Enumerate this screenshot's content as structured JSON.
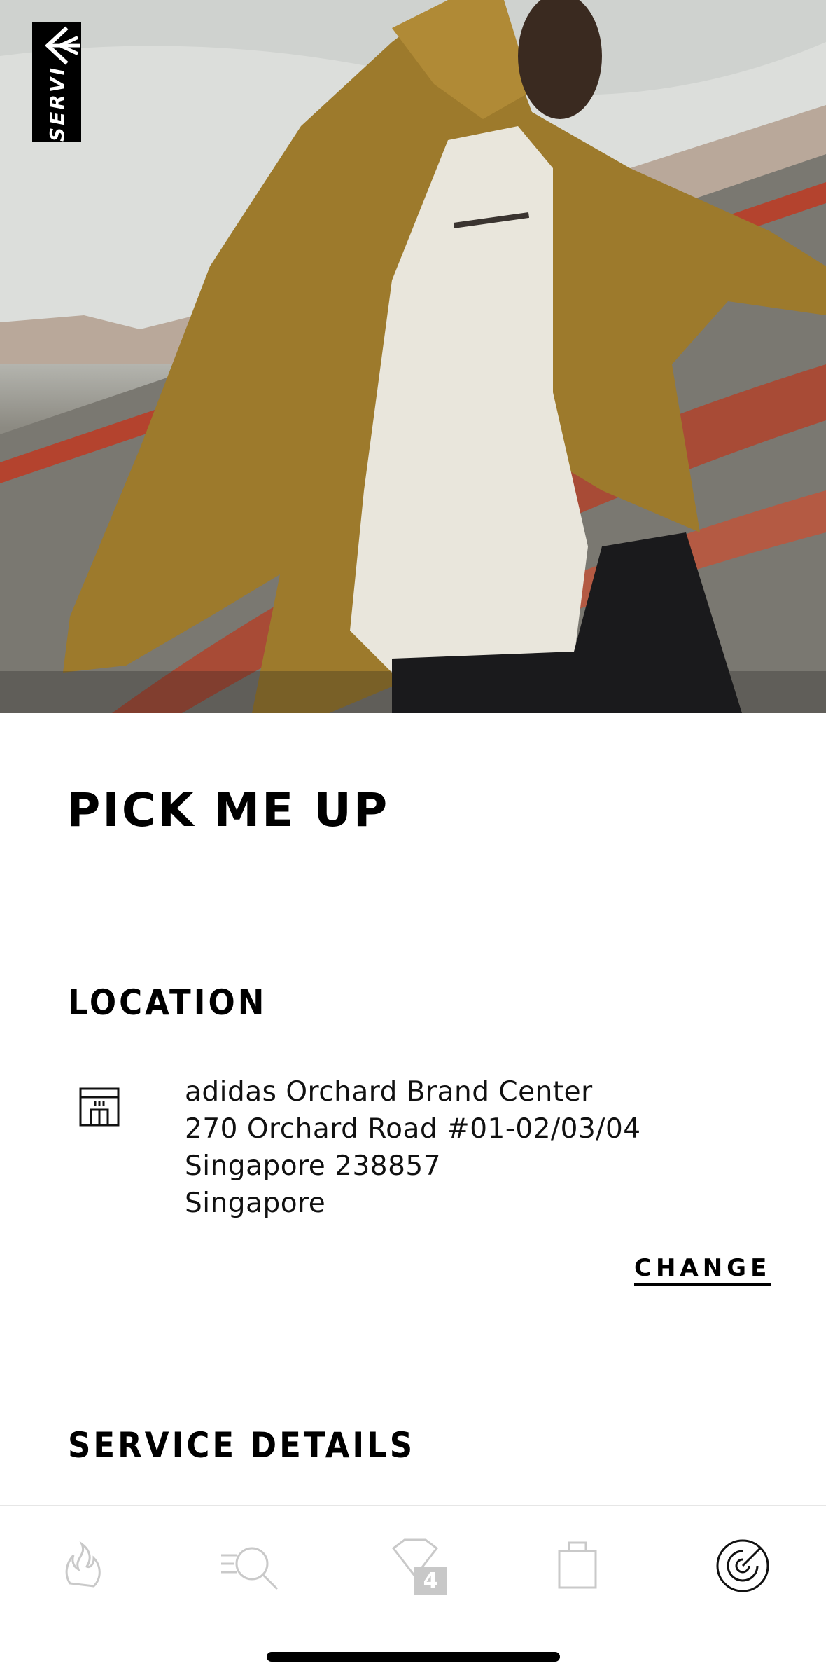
{
  "hero": {
    "back_label": "SERVI"
  },
  "page": {
    "title": "PICK ME UP"
  },
  "location": {
    "heading": "LOCATION",
    "icon": "store-icon",
    "address_lines": [
      "adidas Orchard Brand Center",
      "270 Orchard Road #01-02/03/04",
      "Singapore 238857",
      "Singapore"
    ],
    "change_label": "CHANGE"
  },
  "service_details": {
    "heading": "SERVICE DETAILS"
  },
  "tabbar": {
    "tabs": [
      {
        "name": "trending",
        "icon": "flame-icon"
      },
      {
        "name": "search",
        "icon": "search-icon"
      },
      {
        "name": "wishlist",
        "icon": "heart-icon",
        "badge": "4"
      },
      {
        "name": "bag",
        "icon": "bag-icon"
      },
      {
        "name": "services",
        "icon": "radar-icon"
      }
    ]
  }
}
